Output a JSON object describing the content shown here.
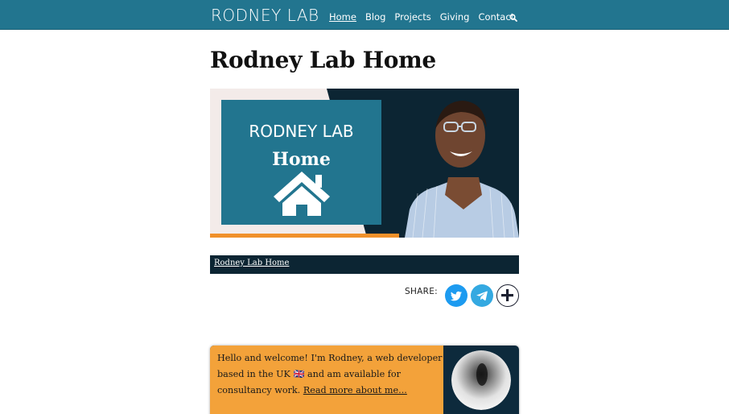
{
  "header": {
    "brand": "RODNEY LAB",
    "nav": [
      {
        "label": "Home",
        "active": true
      },
      {
        "label": "Blog",
        "active": false
      },
      {
        "label": "Projects",
        "active": false
      },
      {
        "label": "Giving",
        "active": false
      },
      {
        "label": "Contact",
        "active": false
      }
    ],
    "search_icon": "search-icon"
  },
  "main": {
    "title": "Rodney Lab Home",
    "hero": {
      "box_title": "RODNEY LAB",
      "box_subtitle": "Home",
      "icon": "house-icon"
    },
    "caption": "Rodney Lab Home",
    "share": {
      "label": "SHARE:",
      "buttons": [
        "twitter-icon",
        "telegram-icon",
        "plus-icon"
      ]
    },
    "intro": {
      "text": "Hello and welcome! I'm Rodney, a web developer based in the UK 🇬🇧 and am available for consultancy work.",
      "link": "Read more about me..."
    }
  },
  "colors": {
    "header_bg": "#22758f",
    "brand_box": "#22758f",
    "dark_navy": "#0c2533",
    "intro_bg": "#f3a23a",
    "twitter": "#1d9bf0",
    "telegram": "#34a9e1"
  }
}
